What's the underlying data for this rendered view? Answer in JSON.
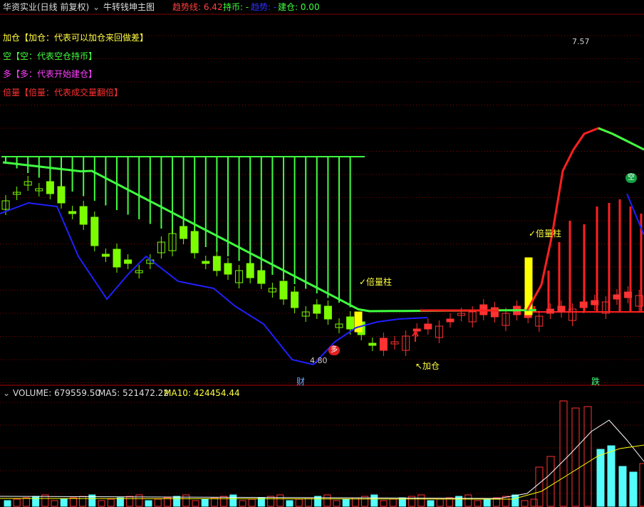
{
  "colors": {
    "bg": "#000000",
    "up_candle": "#ff3232",
    "down_candle": "#54fcfc",
    "green_candle": "#7cfc00",
    "trend_red": "#ff2020",
    "trend_green": "#40ff40",
    "ma_blue": "#2020ff",
    "yellow": "#ffff00",
    "grid": "#800000",
    "vol_white": "#ffffff",
    "vol_yellow": "#ffff00",
    "vol_cyan": "#54fcfc"
  },
  "header": {
    "stock": "华资实业(日线 前复权)",
    "indicator_dropdown": "牛转钱坤主图",
    "trend_line_label": "趋势线: 6.42",
    "hold_label": "持币: -",
    "trend_label": "趋势: -",
    "build_label": "建仓: 0.00"
  },
  "legend": {
    "jiacang": "加仓【加仓：代表可以加仓来回做差】",
    "kong": "空【空：代表空仓持币】",
    "duo": "多【多：代表开始建仓】",
    "beiliang": "倍量【倍量：代表成交量翻倍】"
  },
  "annotations": {
    "high_price": "7.57",
    "low_price": "4.80",
    "beiliang_1": "✓倍量柱",
    "beiliang_2": "✓倍量柱",
    "jiacang": "↖加仓",
    "duo_badge": "多",
    "kong_badge": "空",
    "cai": "财",
    "die": "跌"
  },
  "volume_header": {
    "volume": "VOLUME: 679559.50",
    "ma5": "MA5: 521472.22",
    "ma10": "MA10: 424454.44"
  }
}
